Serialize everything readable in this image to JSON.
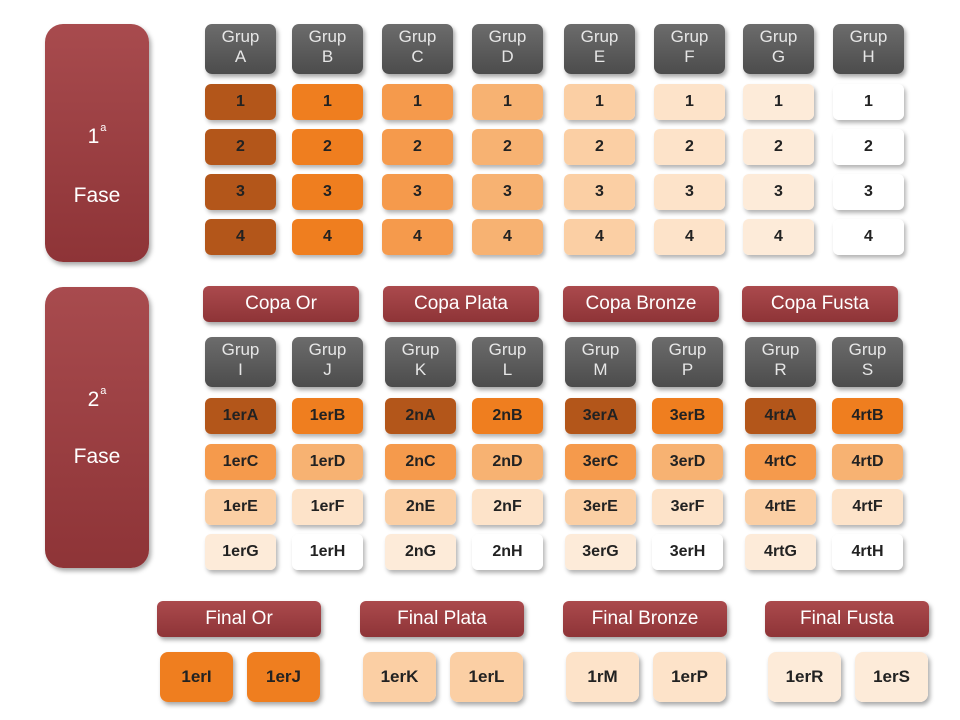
{
  "phase1": {
    "number": "1",
    "ordinal": "a",
    "label": "Fase"
  },
  "phase2": {
    "number": "2",
    "ordinal": "a",
    "label": "Fase"
  },
  "colors": {
    "c1": "#b3561a",
    "c2": "#ef7e1f",
    "c3": "#f59a4c",
    "c4": "#f7b272",
    "c5": "#fbcfa4",
    "c6": "#fde3c9",
    "c7": "#fdebd9",
    "c8": "#ffffff",
    "phase": "#9a3d40",
    "header": "#5e5e5e"
  },
  "groups1": [
    {
      "line1": "Grup",
      "line2": "A",
      "color": "c1",
      "cells": [
        "1",
        "2",
        "3",
        "4"
      ]
    },
    {
      "line1": "Grup",
      "line2": "B",
      "color": "c2",
      "cells": [
        "1",
        "2",
        "3",
        "4"
      ]
    },
    {
      "line1": "Grup",
      "line2": "C",
      "color": "c3",
      "cells": [
        "1",
        "2",
        "3",
        "4"
      ]
    },
    {
      "line1": "Grup",
      "line2": "D",
      "color": "c4",
      "cells": [
        "1",
        "2",
        "3",
        "4"
      ]
    },
    {
      "line1": "Grup",
      "line2": "E",
      "color": "c5",
      "cells": [
        "1",
        "2",
        "3",
        "4"
      ]
    },
    {
      "line1": "Grup",
      "line2": "F",
      "color": "c6",
      "cells": [
        "1",
        "2",
        "3",
        "4"
      ]
    },
    {
      "line1": "Grup",
      "line2": "G",
      "color": "c7",
      "cells": [
        "1",
        "2",
        "3",
        "4"
      ]
    },
    {
      "line1": "Grup",
      "line2": "H",
      "color": "c8",
      "cells": [
        "1",
        "2",
        "3",
        "4"
      ]
    }
  ],
  "cups": [
    "Copa Or",
    "Copa Plata",
    "Copa Bronze",
    "Copa Fusta"
  ],
  "groups2": [
    {
      "line1": "Grup",
      "line2": "I",
      "cells": [
        {
          "t": "1erA",
          "c": "c1"
        },
        {
          "t": "1erC",
          "c": "c3"
        },
        {
          "t": "1erE",
          "c": "c5"
        },
        {
          "t": "1erG",
          "c": "c7"
        }
      ]
    },
    {
      "line1": "Grup",
      "line2": "J",
      "cells": [
        {
          "t": "1erB",
          "c": "c2"
        },
        {
          "t": "1erD",
          "c": "c4"
        },
        {
          "t": "1erF",
          "c": "c6"
        },
        {
          "t": "1erH",
          "c": "c8"
        }
      ]
    },
    {
      "line1": "Grup",
      "line2": "K",
      "cells": [
        {
          "t": "2nA",
          "c": "c1"
        },
        {
          "t": "2nC",
          "c": "c3"
        },
        {
          "t": "2nE",
          "c": "c5"
        },
        {
          "t": "2nG",
          "c": "c7"
        }
      ]
    },
    {
      "line1": "Grup",
      "line2": "L",
      "cells": [
        {
          "t": "2nB",
          "c": "c2"
        },
        {
          "t": "2nD",
          "c": "c4"
        },
        {
          "t": "2nF",
          "c": "c6"
        },
        {
          "t": "2nH",
          "c": "c8"
        }
      ]
    },
    {
      "line1": "Grup",
      "line2": "M",
      "cells": [
        {
          "t": "3erA",
          "c": "c1"
        },
        {
          "t": "3erC",
          "c": "c3"
        },
        {
          "t": "3erE",
          "c": "c5"
        },
        {
          "t": "3erG",
          "c": "c7"
        }
      ]
    },
    {
      "line1": "Grup",
      "line2": "P",
      "cells": [
        {
          "t": "3erB",
          "c": "c2"
        },
        {
          "t": "3erD",
          "c": "c4"
        },
        {
          "t": "3erF",
          "c": "c6"
        },
        {
          "t": "3erH",
          "c": "c8"
        }
      ]
    },
    {
      "line1": "Grup",
      "line2": "R",
      "cells": [
        {
          "t": "4rtA",
          "c": "c1"
        },
        {
          "t": "4rtC",
          "c": "c3"
        },
        {
          "t": "4rtE",
          "c": "c5"
        },
        {
          "t": "4rtG",
          "c": "c7"
        }
      ]
    },
    {
      "line1": "Grup",
      "line2": "S",
      "cells": [
        {
          "t": "4rtB",
          "c": "c2"
        },
        {
          "t": "4rtD",
          "c": "c4"
        },
        {
          "t": "4rtF",
          "c": "c6"
        },
        {
          "t": "4rtH",
          "c": "c8"
        }
      ]
    }
  ],
  "finals": [
    {
      "title": "Final Or",
      "items": [
        {
          "t": "1erI",
          "c": "c2"
        },
        {
          "t": "1erJ",
          "c": "c2"
        }
      ]
    },
    {
      "title": "Final Plata",
      "items": [
        {
          "t": "1erK",
          "c": "c5"
        },
        {
          "t": "1erL",
          "c": "c5"
        }
      ]
    },
    {
      "title": "Final Bronze",
      "items": [
        {
          "t": "1rM",
          "c": "c6"
        },
        {
          "t": "1erP",
          "c": "c6"
        }
      ]
    },
    {
      "title": "Final Fusta",
      "items": [
        {
          "t": "1erR",
          "c": "c7"
        },
        {
          "t": "1erS",
          "c": "c7"
        }
      ]
    }
  ]
}
